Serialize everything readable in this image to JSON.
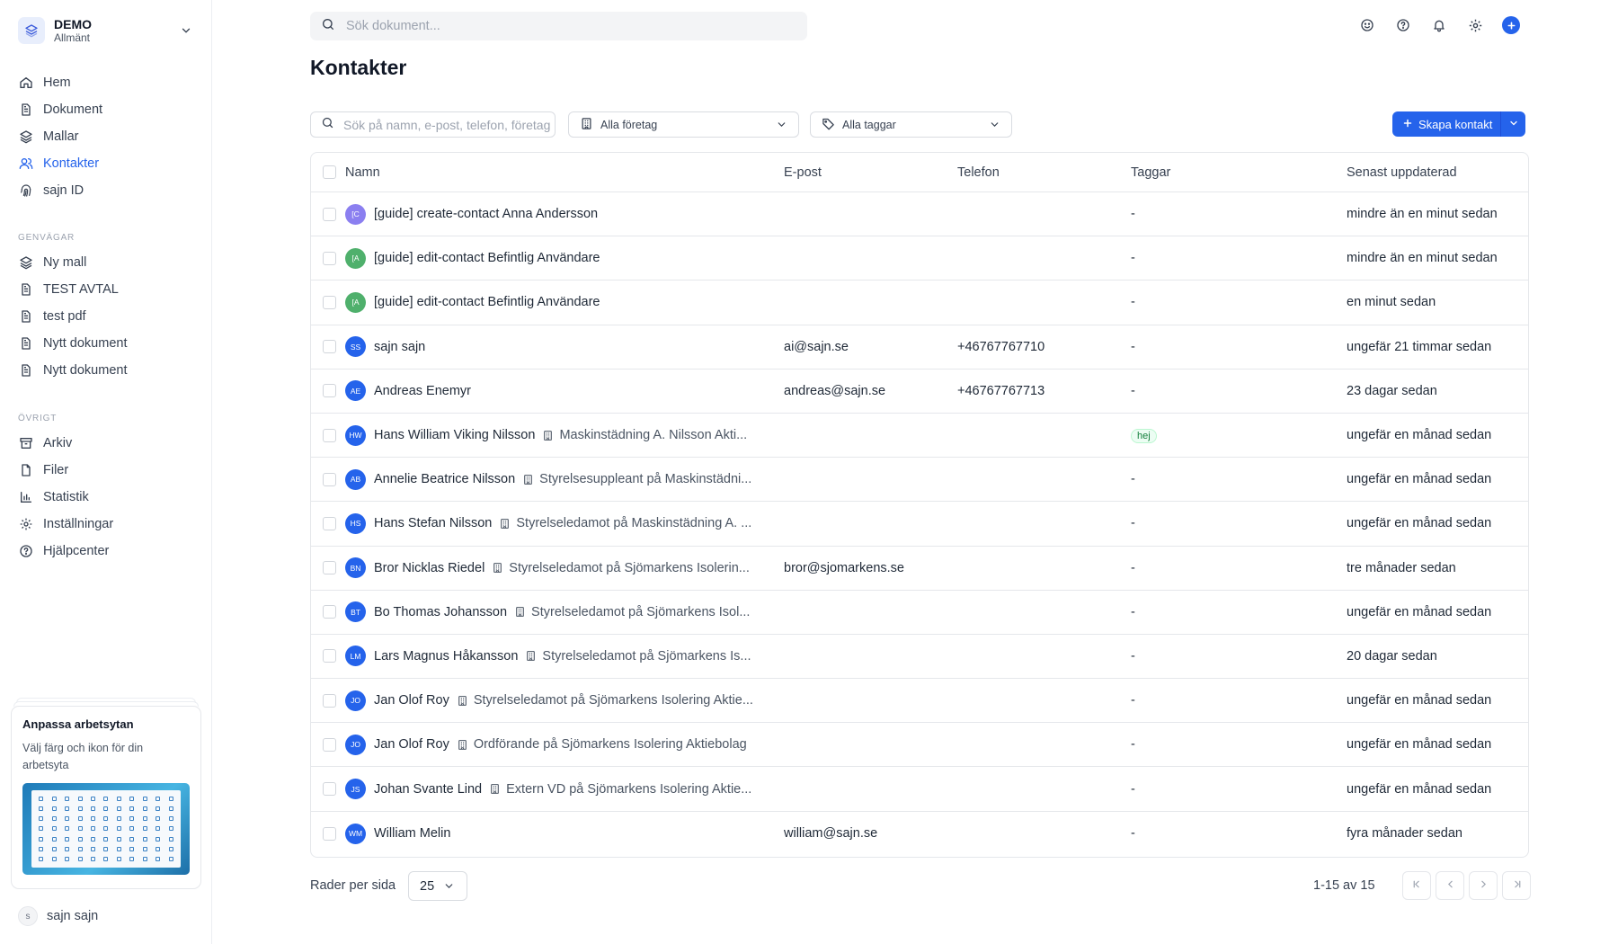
{
  "workspace": {
    "name": "DEMO",
    "subtitle": "Allmänt"
  },
  "nav_main": [
    {
      "label": "Hem",
      "icon": "home-icon"
    },
    {
      "label": "Dokument",
      "icon": "document-icon"
    },
    {
      "label": "Mallar",
      "icon": "layers-icon"
    },
    {
      "label": "Kontakter",
      "icon": "users-icon",
      "active": true
    },
    {
      "label": "sajn ID",
      "icon": "fingerprint-icon"
    }
  ],
  "shortcuts": {
    "heading": "GENVÄGAR",
    "items": [
      {
        "label": "Ny mall",
        "icon": "layers-icon"
      },
      {
        "label": "TEST AVTAL",
        "icon": "document-icon"
      },
      {
        "label": "test pdf",
        "icon": "document-icon"
      },
      {
        "label": "Nytt dokument",
        "icon": "document-icon"
      },
      {
        "label": "Nytt dokument",
        "icon": "document-icon"
      }
    ]
  },
  "other": {
    "heading": "ÖVRIGT",
    "items": [
      {
        "label": "Arkiv",
        "icon": "archive-icon"
      },
      {
        "label": "Filer",
        "icon": "file-icon"
      },
      {
        "label": "Statistik",
        "icon": "bar-chart-icon"
      },
      {
        "label": "Inställningar",
        "icon": "gear-icon"
      },
      {
        "label": "Hjälpcenter",
        "icon": "help-icon"
      }
    ]
  },
  "promo": {
    "title": "Anpassa arbetsytan",
    "text": "Välj färg och ikon för din arbetsyta"
  },
  "user": {
    "initial": "s",
    "name": "sajn sajn"
  },
  "topbar": {
    "search_placeholder": "Sök dokument..."
  },
  "page": {
    "title": "Kontakter"
  },
  "filters": {
    "search_placeholder": "Sök på namn, e-post, telefon, företag",
    "company": "Alla företag",
    "tags": "Alla taggar",
    "create_label": "Skapa kontakt"
  },
  "table": {
    "headers": {
      "name": "Namn",
      "email": "E-post",
      "phone": "Telefon",
      "tags": "Taggar",
      "updated": "Senast uppdaterad"
    },
    "rows": [
      {
        "initials": "[C",
        "color": "#8b7ff0",
        "name": "[guide] create-contact Anna Andersson",
        "role": "",
        "email": "",
        "phone": "",
        "tag": "-",
        "updated": "mindre än en minut sedan"
      },
      {
        "initials": "[A",
        "color": "#4fb06c",
        "name": "[guide] edit-contact Befintlig Användare",
        "role": "",
        "email": "",
        "phone": "",
        "tag": "-",
        "updated": "mindre än en minut sedan"
      },
      {
        "initials": "[A",
        "color": "#4fb06c",
        "name": "[guide] edit-contact Befintlig Användare",
        "role": "",
        "email": "",
        "phone": "",
        "tag": "-",
        "updated": "en minut sedan"
      },
      {
        "initials": "SS",
        "color": "#2563eb",
        "name": "sajn sajn",
        "role": "",
        "email": "ai@sajn.se",
        "phone": "+46767767710",
        "tag": "-",
        "updated": "ungefär 21 timmar sedan"
      },
      {
        "initials": "AE",
        "color": "#2563eb",
        "name": "Andreas Enemyr",
        "role": "",
        "email": "andreas@sajn.se",
        "phone": "+46767767713",
        "tag": "-",
        "updated": "23 dagar sedan"
      },
      {
        "initials": "HW",
        "color": "#2563eb",
        "name": "Hans William Viking Nilsson",
        "role": "Maskinstädning A. Nilsson Akti...",
        "email": "",
        "phone": "",
        "tag": "hej",
        "tag_badge": true,
        "updated": "ungefär en månad sedan"
      },
      {
        "initials": "AB",
        "color": "#2563eb",
        "name": "Annelie Beatrice Nilsson",
        "role": "Styrelsesuppleant på Maskinstädni...",
        "email": "",
        "phone": "",
        "tag": "-",
        "updated": "ungefär en månad sedan"
      },
      {
        "initials": "HS",
        "color": "#2563eb",
        "name": "Hans Stefan Nilsson",
        "role": "Styrelseledamot på Maskinstädning A. ...",
        "email": "",
        "phone": "",
        "tag": "-",
        "updated": "ungefär en månad sedan"
      },
      {
        "initials": "BN",
        "color": "#2563eb",
        "name": "Bror Nicklas Riedel",
        "role": "Styrelseledamot på Sjömarkens Isolerin...",
        "email": "bror@sjomarkens.se",
        "phone": "",
        "tag": "-",
        "updated": "tre månader sedan"
      },
      {
        "initials": "BT",
        "color": "#2563eb",
        "name": "Bo Thomas Johansson",
        "role": "Styrelseledamot på Sjömarkens Isol...",
        "email": "",
        "phone": "",
        "tag": "-",
        "updated": "ungefär en månad sedan"
      },
      {
        "initials": "LM",
        "color": "#2563eb",
        "name": "Lars Magnus Håkansson",
        "role": "Styrelseledamot på Sjömarkens Is...",
        "email": "",
        "phone": "",
        "tag": "-",
        "updated": "20 dagar sedan"
      },
      {
        "initials": "JO",
        "color": "#2563eb",
        "name": "Jan Olof Roy",
        "role": "Styrelseledamot på Sjömarkens Isolering Aktie...",
        "email": "",
        "phone": "",
        "tag": "-",
        "updated": "ungefär en månad sedan"
      },
      {
        "initials": "JO",
        "color": "#2563eb",
        "name": "Jan Olof Roy",
        "role": "Ordförande på Sjömarkens Isolering Aktiebolag",
        "email": "",
        "phone": "",
        "tag": "-",
        "updated": "ungefär en månad sedan"
      },
      {
        "initials": "JS",
        "color": "#2563eb",
        "name": "Johan Svante Lind",
        "role": "Extern VD på Sjömarkens Isolering Aktie...",
        "email": "",
        "phone": "",
        "tag": "-",
        "updated": "ungefär en månad sedan"
      },
      {
        "initials": "WM",
        "color": "#2563eb",
        "name": "William Melin",
        "role": "",
        "email": "william@sajn.se",
        "phone": "",
        "tag": "-",
        "updated": "fyra månader sedan"
      }
    ]
  },
  "pagination": {
    "rows_label": "Rader per sida",
    "rows_value": "25",
    "range": "1-15 av 15"
  }
}
